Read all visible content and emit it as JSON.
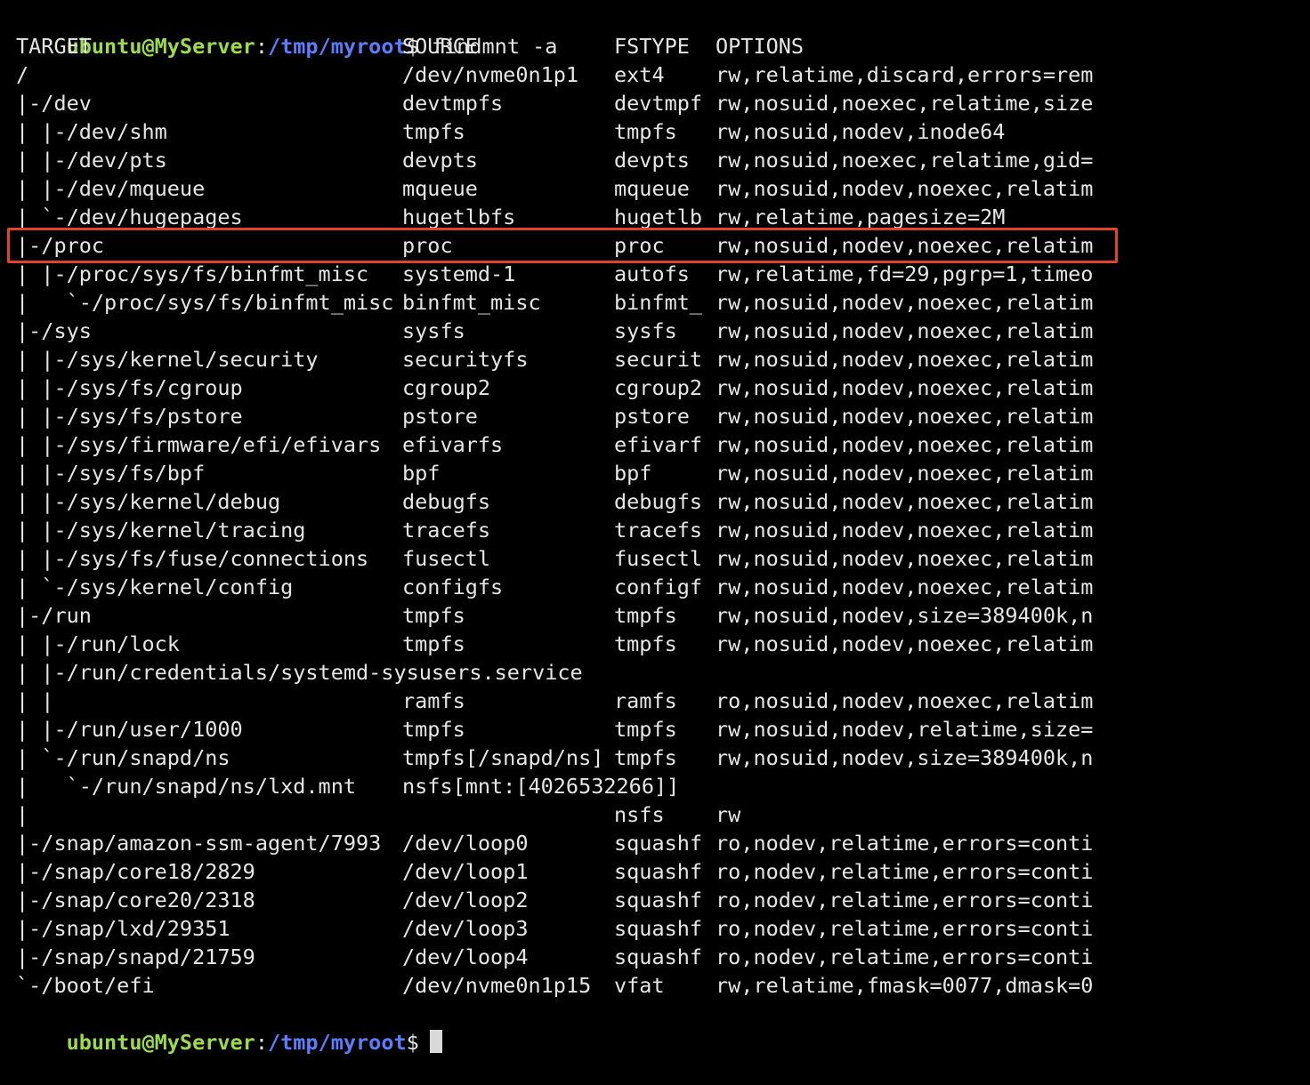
{
  "prompt": {
    "user_host": "ubuntu@MyServer",
    "colon": ":",
    "path": "/tmp/myroot",
    "symbol": "$",
    "command": "findmnt -a"
  },
  "header": {
    "target": "TARGET",
    "source": "SOURCE",
    "fstype": "FSTYPE",
    "options": "OPTIONS"
  },
  "rows": [
    {
      "target": "/",
      "source": "/dev/nvme0n1p1",
      "fstype": "ext4",
      "options": "rw,relatime,discard,errors=rem"
    },
    {
      "target": "|-/dev",
      "source": "devtmpfs",
      "fstype": "devtmpf",
      "options": "rw,nosuid,noexec,relatime,size"
    },
    {
      "target": "| |-/dev/shm",
      "source": "tmpfs",
      "fstype": "tmpfs",
      "options": "rw,nosuid,nodev,inode64"
    },
    {
      "target": "| |-/dev/pts",
      "source": "devpts",
      "fstype": "devpts",
      "options": "rw,nosuid,noexec,relatime,gid="
    },
    {
      "target": "| |-/dev/mqueue",
      "source": "mqueue",
      "fstype": "mqueue",
      "options": "rw,nosuid,nodev,noexec,relatim"
    },
    {
      "target": "| `-/dev/hugepages",
      "source": "hugetlbfs",
      "fstype": "hugetlb",
      "options": "rw,relatime,pagesize=2M"
    },
    {
      "target": "|-/proc",
      "source": "proc",
      "fstype": "proc",
      "options": "rw,nosuid,nodev,noexec,relatim"
    },
    {
      "target": "| |-/proc/sys/fs/binfmt_misc",
      "source": "systemd-1",
      "fstype": "autofs",
      "options": "rw,relatime,fd=29,pgrp=1,timeo"
    },
    {
      "target": "|   `-/proc/sys/fs/binfmt_misc",
      "source": "binfmt_misc",
      "fstype": "binfmt_",
      "options": "rw,nosuid,nodev,noexec,relatim"
    },
    {
      "target": "|-/sys",
      "source": "sysfs",
      "fstype": "sysfs",
      "options": "rw,nosuid,nodev,noexec,relatim"
    },
    {
      "target": "| |-/sys/kernel/security",
      "source": "securityfs",
      "fstype": "securit",
      "options": "rw,nosuid,nodev,noexec,relatim"
    },
    {
      "target": "| |-/sys/fs/cgroup",
      "source": "cgroup2",
      "fstype": "cgroup2",
      "options": "rw,nosuid,nodev,noexec,relatim"
    },
    {
      "target": "| |-/sys/fs/pstore",
      "source": "pstore",
      "fstype": "pstore",
      "options": "rw,nosuid,nodev,noexec,relatim"
    },
    {
      "target": "| |-/sys/firmware/efi/efivars",
      "source": "efivarfs",
      "fstype": "efivarf",
      "options": "rw,nosuid,nodev,noexec,relatim"
    },
    {
      "target": "| |-/sys/fs/bpf",
      "source": "bpf",
      "fstype": "bpf",
      "options": "rw,nosuid,nodev,noexec,relatim"
    },
    {
      "target": "| |-/sys/kernel/debug",
      "source": "debugfs",
      "fstype": "debugfs",
      "options": "rw,nosuid,nodev,noexec,relatim"
    },
    {
      "target": "| |-/sys/kernel/tracing",
      "source": "tracefs",
      "fstype": "tracefs",
      "options": "rw,nosuid,nodev,noexec,relatim"
    },
    {
      "target": "| |-/sys/fs/fuse/connections",
      "source": "fusectl",
      "fstype": "fusectl",
      "options": "rw,nosuid,nodev,noexec,relatim"
    },
    {
      "target": "| `-/sys/kernel/config",
      "source": "configfs",
      "fstype": "configf",
      "options": "rw,nosuid,nodev,noexec,relatim"
    },
    {
      "target": "|-/run",
      "source": "tmpfs",
      "fstype": "tmpfs",
      "options": "rw,nosuid,nodev,size=389400k,n"
    },
    {
      "target": "| |-/run/lock",
      "source": "tmpfs",
      "fstype": "tmpfs",
      "options": "rw,nosuid,nodev,noexec,relatim"
    },
    {
      "target": "| |-/run/credentials/systemd-sysusers.service",
      "source": "",
      "fstype": "",
      "options": ""
    },
    {
      "target": "| |",
      "source": "ramfs",
      "fstype": "ramfs",
      "options": "ro,nosuid,nodev,noexec,relatim"
    },
    {
      "target": "| |-/run/user/1000",
      "source": "tmpfs",
      "fstype": "tmpfs",
      "options": "rw,nosuid,nodev,relatime,size="
    },
    {
      "target": "| `-/run/snapd/ns",
      "source": "tmpfs[/snapd/ns]",
      "fstype": "tmpfs",
      "options": "rw,nosuid,nodev,size=389400k,n"
    },
    {
      "target": "|   `-/run/snapd/ns/lxd.mnt",
      "source": "nsfs[mnt:[4026532266]]",
      "fstype": "",
      "options": ""
    },
    {
      "target": "|",
      "source": "",
      "fstype": "nsfs",
      "options": "rw"
    },
    {
      "target": "|-/snap/amazon-ssm-agent/7993",
      "source": "/dev/loop0",
      "fstype": "squashf",
      "options": "ro,nodev,relatime,errors=conti"
    },
    {
      "target": "|-/snap/core18/2829",
      "source": "/dev/loop1",
      "fstype": "squashf",
      "options": "ro,nodev,relatime,errors=conti"
    },
    {
      "target": "|-/snap/core20/2318",
      "source": "/dev/loop2",
      "fstype": "squashf",
      "options": "ro,nodev,relatime,errors=conti"
    },
    {
      "target": "|-/snap/lxd/29351",
      "source": "/dev/loop3",
      "fstype": "squashf",
      "options": "ro,nodev,relatime,errors=conti"
    },
    {
      "target": "|-/snap/snapd/21759",
      "source": "/dev/loop4",
      "fstype": "squashf",
      "options": "ro,nodev,relatime,errors=conti"
    },
    {
      "target": "`-/boot/efi",
      "source": "/dev/nvme0n1p15",
      "fstype": "vfat",
      "options": "rw,relatime,fmask=0077,dmask=0"
    }
  ],
  "highlight_color": "#e0432b"
}
